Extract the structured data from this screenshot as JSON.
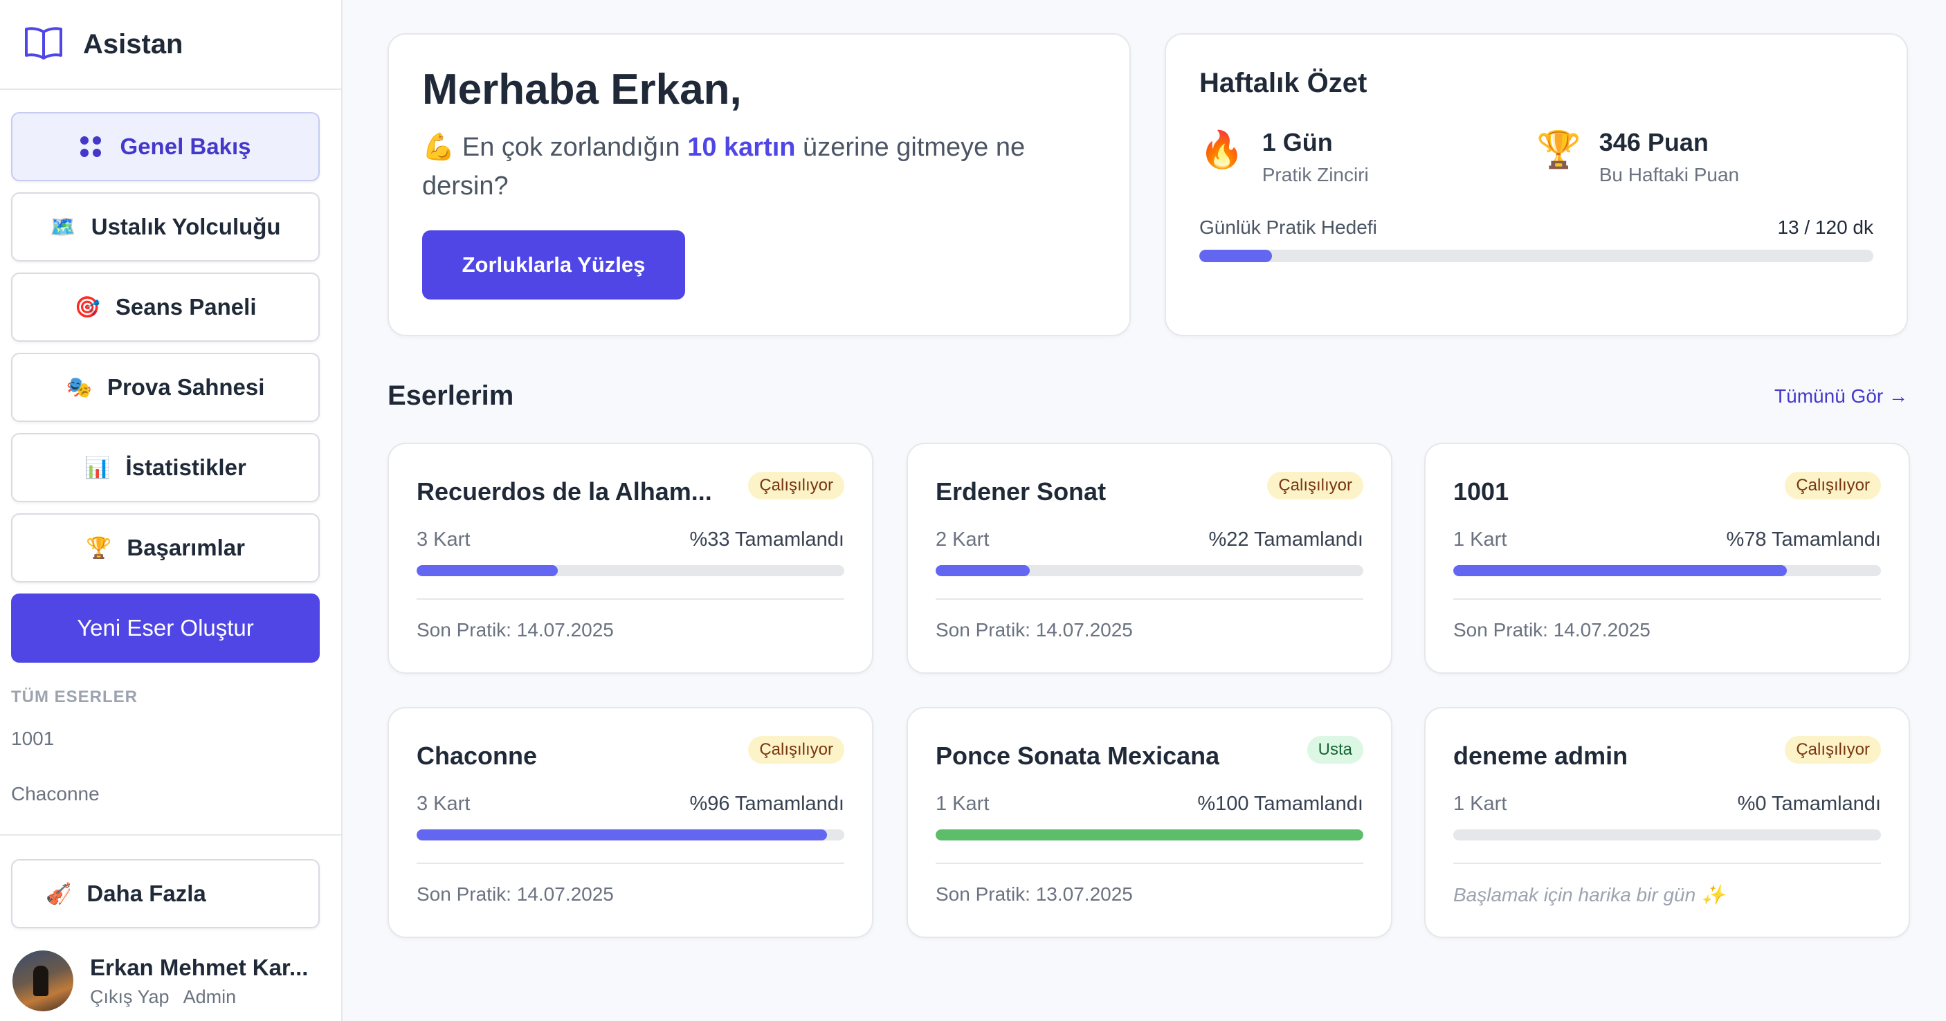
{
  "sidebar": {
    "brand": "Asistan",
    "nav": [
      {
        "icon": "grid-icon",
        "label": "Genel Bakış",
        "active": true
      },
      {
        "icon": "🗺️",
        "label": "Ustalık Yolculuğu"
      },
      {
        "icon": "🎯",
        "label": "Seans Paneli"
      },
      {
        "icon": "🎭",
        "label": "Prova Sahnesi"
      },
      {
        "icon": "📊",
        "label": "İstatistikler"
      },
      {
        "icon": "🏆",
        "label": "Başarımlar"
      }
    ],
    "new_work": "Yeni Eser Oluştur",
    "section_label": "TÜM ESERLER",
    "works": [
      "1001",
      "Chaconne"
    ],
    "more": {
      "icon": "🎻",
      "label": "Daha Fazla"
    },
    "user": {
      "name": "Erkan Mehmet Kar...",
      "logout": "Çıkış Yap",
      "role": "Admin"
    }
  },
  "greeting": {
    "title": "Merhaba Erkan,",
    "emoji": "💪",
    "text_before": " En çok zorlandığın ",
    "highlight": "10 kartın",
    "text_after": " üzerine gitmeye ne dersin?",
    "button": "Zorluklarla Yüzleş"
  },
  "weekly": {
    "title": "Haftalık Özet",
    "streak": {
      "emoji": "🔥",
      "value": "1 Gün",
      "label": "Pratik Zinciri"
    },
    "points": {
      "emoji": "🏆",
      "value": "346 Puan",
      "label": "Bu Haftaki Puan"
    },
    "goal_label": "Günlük Pratik Hedefi",
    "goal_value": "13 / 120 dk",
    "goal_progress": 0.108
  },
  "works_section": {
    "title": "Eserlerim",
    "see_all": "Tümünü Gör →"
  },
  "works": [
    {
      "title": "Recuerdos de la Alham...",
      "badge": "Çalışılıyor",
      "cards": "3 Kart",
      "percent_text": "%33 Tamamlandı",
      "progress": 0.33,
      "last": "Son Pratik: 14.07.2025"
    },
    {
      "title": "Erdener Sonat",
      "badge": "Çalışılıyor",
      "cards": "2 Kart",
      "percent_text": "%22 Tamamlandı",
      "progress": 0.22,
      "last": "Son Pratik: 14.07.2025"
    },
    {
      "title": "1001",
      "badge": "Çalışılıyor",
      "cards": "1 Kart",
      "percent_text": "%78 Tamamlandı",
      "progress": 0.78,
      "last": "Son Pratik: 14.07.2025"
    },
    {
      "title": "Chaconne",
      "badge": "Çalışılıyor",
      "cards": "3 Kart",
      "percent_text": "%96 Tamamlandı",
      "progress": 0.96,
      "last": "Son Pratik: 14.07.2025"
    },
    {
      "title": "Ponce Sonata Mexicana",
      "badge": "Usta",
      "cards": "1 Kart",
      "percent_text": "%100 Tamamlandı",
      "progress": 1.0,
      "last": "Son Pratik: 13.07.2025"
    },
    {
      "title": "deneme admin",
      "badge": "Çalışılıyor",
      "cards": "1 Kart",
      "percent_text": "%0 Tamamlandı",
      "progress": 0.0,
      "last": "Başlamak için harika bir gün ✨"
    }
  ],
  "colors": {
    "accent": "#4f46e5",
    "progress": "#6366f1",
    "complete": "#5cbd6b"
  }
}
